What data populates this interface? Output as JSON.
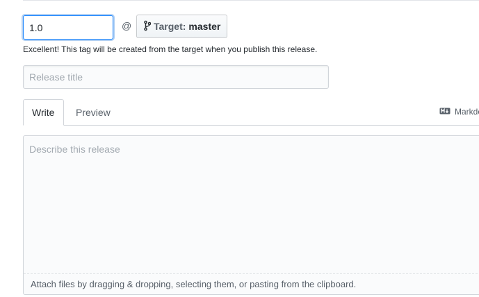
{
  "release_form": {
    "tag_input": {
      "value": "1.0"
    },
    "at_sign": "@",
    "target_button": {
      "label": "Target:",
      "branch": "master"
    },
    "tag_note": "Excellent! This tag will be created from the target when you publish this release.",
    "title_input": {
      "placeholder": "Release title",
      "value": ""
    },
    "tabs": [
      {
        "label": "Write",
        "active": true
      },
      {
        "label": "Preview",
        "active": false
      }
    ],
    "markdown_hint": "Markdown",
    "editor": {
      "placeholder": "Describe this release",
      "attach_text": "Attach files by dragging & dropping, selecting them, or pasting from the clipboard."
    }
  },
  "icons": {
    "branch": "git-branch-icon",
    "markdown": "markdown-icon"
  },
  "colors": {
    "focus_border": "#2188ff",
    "text": "#24292e",
    "muted": "#586069",
    "border": "#d1d5da"
  }
}
